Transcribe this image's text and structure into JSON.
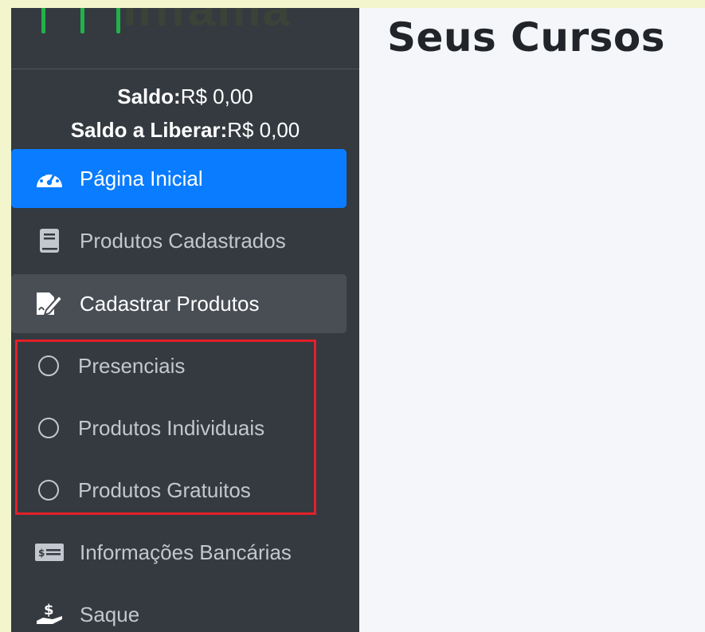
{
  "brand": {
    "logo_text": "Infama"
  },
  "balance": {
    "saldo_label": "Saldo:",
    "saldo_value": "R$ 0,00",
    "liberar_label": "Saldo a Liberar:",
    "liberar_value": "R$ 0,00"
  },
  "sidebar": {
    "items": [
      {
        "label": "Página Inicial",
        "icon": "tachometer-icon",
        "state": "active"
      },
      {
        "label": "Produtos Cadastrados",
        "icon": "book-icon",
        "state": "normal"
      },
      {
        "label": "Cadastrar Produtos",
        "icon": "edit-document-icon",
        "state": "open"
      }
    ],
    "sub_items": [
      {
        "label": "Presenciais",
        "icon": "circle-icon"
      },
      {
        "label": "Produtos Individuais",
        "icon": "circle-icon"
      },
      {
        "label": "Produtos Gratuitos",
        "icon": "circle-icon"
      }
    ],
    "bottom_items": [
      {
        "label": "Informações Bancárias",
        "icon": "money-check-icon"
      },
      {
        "label": "Saque",
        "icon": "hand-dollar-icon"
      }
    ]
  },
  "main": {
    "title": "Seus Cursos"
  },
  "colors": {
    "active": "#0a7cff",
    "sidebar": "#343a40",
    "highlight": "#e3202a"
  }
}
